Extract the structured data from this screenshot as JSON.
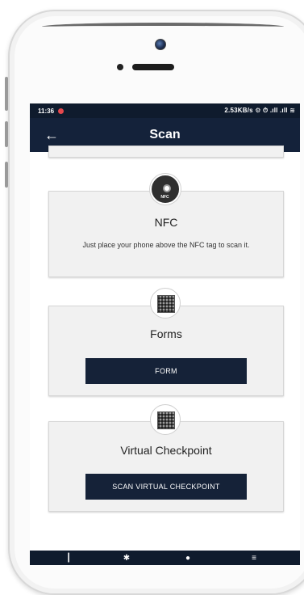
{
  "status_bar": {
    "time": "11:36",
    "right_text": "2.53KB/s ⚙ ⏱ .ıll .ıll ≋"
  },
  "app_bar": {
    "back_icon": "arrow-left-icon",
    "title": "Scan"
  },
  "cards": {
    "nfc": {
      "icon": "nfc-icon",
      "icon_label": "NFC",
      "title": "NFC",
      "description": "Just place your phone above the NFC tag to scan it."
    },
    "forms": {
      "icon": "qr-code-icon",
      "title": "Forms",
      "button_label": "FORM"
    },
    "virtual_checkpoint": {
      "icon": "qr-code-icon",
      "title": "Virtual Checkpoint",
      "button_label": "SCAN VIRTUAL CHECKPOINT"
    }
  },
  "bottom_nav": {
    "icons": [
      "home-icon",
      "brightness-icon",
      "profile-icon",
      "menu-icon"
    ]
  },
  "colors": {
    "app_bar": "#14223a",
    "button": "#152238",
    "card_bg": "#f1f1f1"
  }
}
